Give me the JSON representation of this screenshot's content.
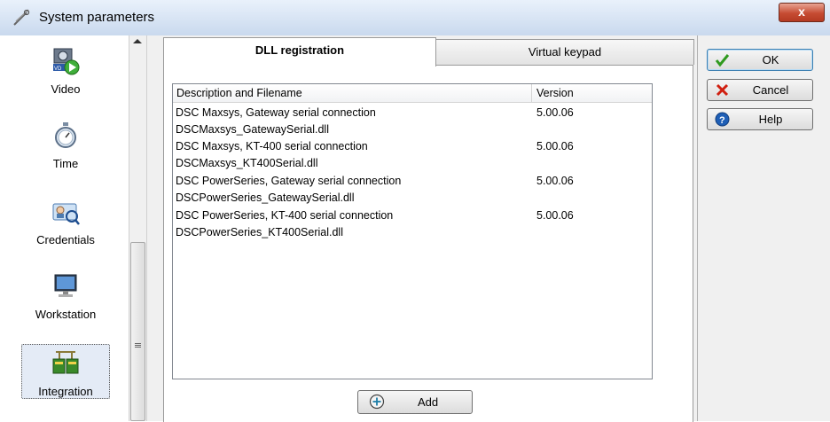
{
  "window": {
    "title": "System parameters",
    "close_label": "x"
  },
  "categories": [
    {
      "label": "Video",
      "icon": "video-icon"
    },
    {
      "label": "Time",
      "icon": "stopwatch-icon"
    },
    {
      "label": "Credentials",
      "icon": "credentials-icon"
    },
    {
      "label": "Workstation",
      "icon": "workstation-icon"
    },
    {
      "label": "Integration",
      "icon": "integration-icon",
      "selected": true
    }
  ],
  "tabs": [
    {
      "label": "DLL registration",
      "active": true
    },
    {
      "label": "Virtual keypad",
      "active": false
    }
  ],
  "dll_list": {
    "columns": [
      "Description and Filename",
      "Version"
    ],
    "rows": [
      {
        "description": "DSC Maxsys, Gateway serial connection",
        "version": "5.00.06"
      },
      {
        "description": "DSCMaxsys_GatewaySerial.dll",
        "version": ""
      },
      {
        "description": "DSC Maxsys, KT-400 serial connection",
        "version": "5.00.06"
      },
      {
        "description": "DSCMaxsys_KT400Serial.dll",
        "version": ""
      },
      {
        "description": "DSC PowerSeries, Gateway serial connection",
        "version": "5.00.06"
      },
      {
        "description": "DSCPowerSeries_GatewaySerial.dll",
        "version": ""
      },
      {
        "description": "DSC PowerSeries, KT-400 serial connection",
        "version": "5.00.06"
      },
      {
        "description": "DSCPowerSeries_KT400Serial.dll",
        "version": ""
      }
    ]
  },
  "add_button": {
    "label": "Add",
    "icon": "add-icon"
  },
  "buttons": {
    "ok": "OK",
    "cancel": "Cancel",
    "help": "Help"
  },
  "colors": {
    "ok_check": "#2f9a1e",
    "cancel_x": "#d01f10",
    "help_blue": "#1f5fb6",
    "close_red": "#c64c33"
  }
}
